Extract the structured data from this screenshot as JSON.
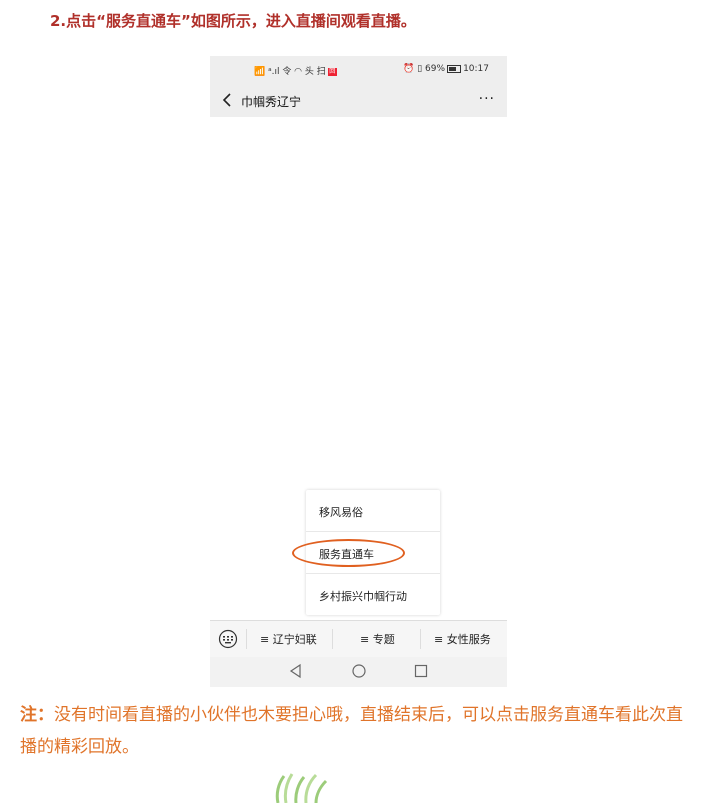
{
  "heading": "2.点击“服务直通车”如图所示，进入直播间观看直播。",
  "status_bar": {
    "left": "📶 ᵃ.ıl 令 ◠ 头 扫",
    "badge": "回",
    "right_prefix": "⏰ ▯ 69%",
    "time": "10:17"
  },
  "nav": {
    "title": "巾帼秀辽宁",
    "more": "···"
  },
  "popup_menu": {
    "items": [
      "移风易俗",
      "服务直通车",
      "乡村振兴巾帼行动"
    ],
    "highlight_color": "#e06020"
  },
  "bottom_menu": {
    "items": [
      "≡ 辽宁妇联",
      "≡ 专题",
      "≡ 女性服务"
    ]
  },
  "note": {
    "label": "注：",
    "text": "没有时间看直播的小伙伴也木要担心哦，直播结束后，可以点击服务直通车看此次直播的精彩回放。",
    "color": "#e0742a"
  },
  "icons": [
    "back-arrow-icon",
    "more-icon",
    "keyboard-icon",
    "back-triangle-icon",
    "home-circle-icon",
    "recents-square-icon",
    "grass-icon"
  ]
}
